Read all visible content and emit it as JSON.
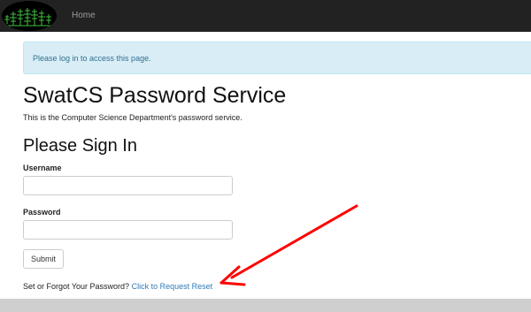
{
  "navbar": {
    "logo_icon": "forest-logo-icon",
    "home_label": "Home",
    "background_color": "#222222"
  },
  "alert": {
    "message": "Please log in to access this page.",
    "background_color": "#d9edf7",
    "text_color": "#31708f"
  },
  "main": {
    "title": "SwatCS Password Service",
    "description": "This is the Computer Science Department's password service.",
    "signin_title": "Please Sign In"
  },
  "form": {
    "username_label": "Username",
    "username_value": "",
    "password_label": "Password",
    "password_value": "",
    "submit_label": "Submit"
  },
  "reset": {
    "prompt": "Set or Forgot Your Password?",
    "link_label": "Click to Request Reset",
    "link_color": "#337ab7"
  },
  "annotation": {
    "arrow_icon": "red-arrow-icon",
    "arrow_color": "#ff0000"
  }
}
